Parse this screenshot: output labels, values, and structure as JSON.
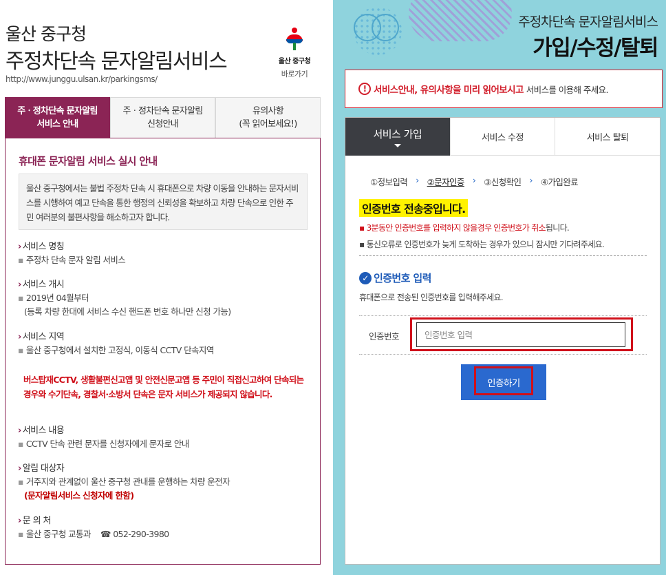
{
  "left": {
    "org": "울산 중구청",
    "title": "주정차단속 문자알림서비스",
    "url": "http://www.junggu.ulsan.kr/parkingsms/",
    "logo_name": "울산 중구청",
    "logo_link": "바로가기",
    "tabs": [
      {
        "line1": "주ㆍ정차단속 문자알림",
        "line2": "서비스 안내"
      },
      {
        "line1": "주ㆍ정차단속 문자알림",
        "line2": "신청안내"
      },
      {
        "line1": "유의사항",
        "line2": "(꼭 읽어보세요!)"
      }
    ],
    "heading": "휴대폰 문자알림 서비스 실시 안내",
    "intro": "울산 중구청에서는 불법 주정차 단속 시 휴대폰으로 차량 이동을 안내하는 문자서비스를 시행하여 예고 단속을 통한 행정의 신뢰성을 확보하고 차량 단속으로 인한 주민 여러분의 불편사항을 해소하고자 합니다.",
    "sections": {
      "name": {
        "head": "서비스 명칭",
        "body": "주정차 단속 문자 알림 서비스"
      },
      "start": {
        "head": "서비스 개시",
        "body": "2019년 04월부터",
        "body2": "(등록 차량 한대에 서비스 수신 핸드폰 번호 하나만 신청 가능)"
      },
      "area": {
        "head": "서비스 지역",
        "body": "울산 중구청에서 설치한 고정식, 이동식 CCTV 단속지역"
      },
      "warning": "버스탑재CCTV, 생활불편신고앱 및 안전신문고앱 등 주민이 직접신고하여 단속되는 경우와 수기단속, 경찰서·소방서 단속은 문자 서비스가 제공되지 않습니다.",
      "content": {
        "head": "서비스 내용",
        "body": "CCTV 단속 관련 문자를 신청자에게 문자로 안내"
      },
      "target": {
        "head": "알림 대상자",
        "body": "거주지와 관계없이 울산 중구청 관내를 운행하는 차량 운전자",
        "body_red": "(문자알림서비스 신청자에 한함)"
      },
      "contact": {
        "head": "문 의 처",
        "body": "울산 중구청 교통과",
        "phone_icon": "☎",
        "phone": "052-290-3980"
      }
    }
  },
  "right": {
    "subtitle": "주정차단속 문자알림서비스",
    "title": "가입/수정/탈퇴",
    "notice_icon": "!",
    "notice_strong": "서비스안내, 유의사항을 미리 읽어보시고",
    "notice_rest": "서비스를 이용해 주세요.",
    "tabs": [
      "서비스 가입",
      "서비스 수정",
      "서비스 탈퇴"
    ],
    "steps": [
      "①정보입력",
      "②문자인증",
      "③신청확인",
      "④가입완료"
    ],
    "step_sep": "›",
    "sending": "인증번호 전송중입니다.",
    "info1_red": "3분동안 인증번호를 입력하지 않을경우 인증번호가 취소",
    "info1_rest": "됩니다.",
    "info2": "통신오류로 인증번호가 늦게 도착하는 경우가 있으니 잠시만 기다려주세요.",
    "bullet": "▪",
    "cert_heading": "인증번호 입력",
    "cert_desc": "휴대폰으로 전송된 인증번호를 입력해주세요.",
    "code_label": "인증번호",
    "code_placeholder": "인증번호 입력",
    "code_value": "",
    "submit": "인증하기"
  },
  "colors": {
    "left_accent": "#8b2455",
    "right_bg": "#8fd3dd",
    "button_blue": "#2a69cf",
    "alert_red": "#d0101a",
    "highlight_yellow": "#fff200"
  }
}
